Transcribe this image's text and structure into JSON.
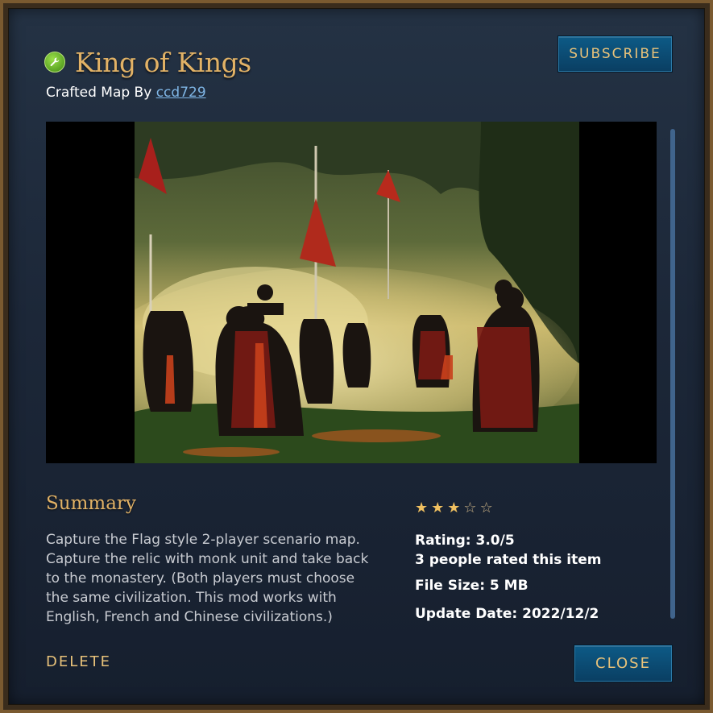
{
  "header": {
    "title": "King of Kings",
    "byline_prefix": "Crafted Map By",
    "author": "ccd729"
  },
  "buttons": {
    "subscribe": "SUBSCRIBE",
    "delete": "DELETE",
    "close": "CLOSE"
  },
  "summary": {
    "title": "Summary",
    "text": "Capture the Flag style 2-player scenario map. Capture the relic with monk unit and take back to the monastery. (Both players must choose the same civilization. This mod works with English, French and Chinese civilizations.)"
  },
  "rating": {
    "stars_filled": 3,
    "stars_total": 5,
    "rating_text": "Rating: 3.0/5",
    "raters_text": "3 people rated this item"
  },
  "file_size": "File Size: 5 MB",
  "update_date": "Update Date: 2022/12/2",
  "icons": {
    "title_icon": "wrench-icon",
    "star": "star-icon"
  },
  "colors": {
    "accent_gold": "#e2b266",
    "button_blue": "#0d5a86",
    "link": "#7fb6e6"
  }
}
